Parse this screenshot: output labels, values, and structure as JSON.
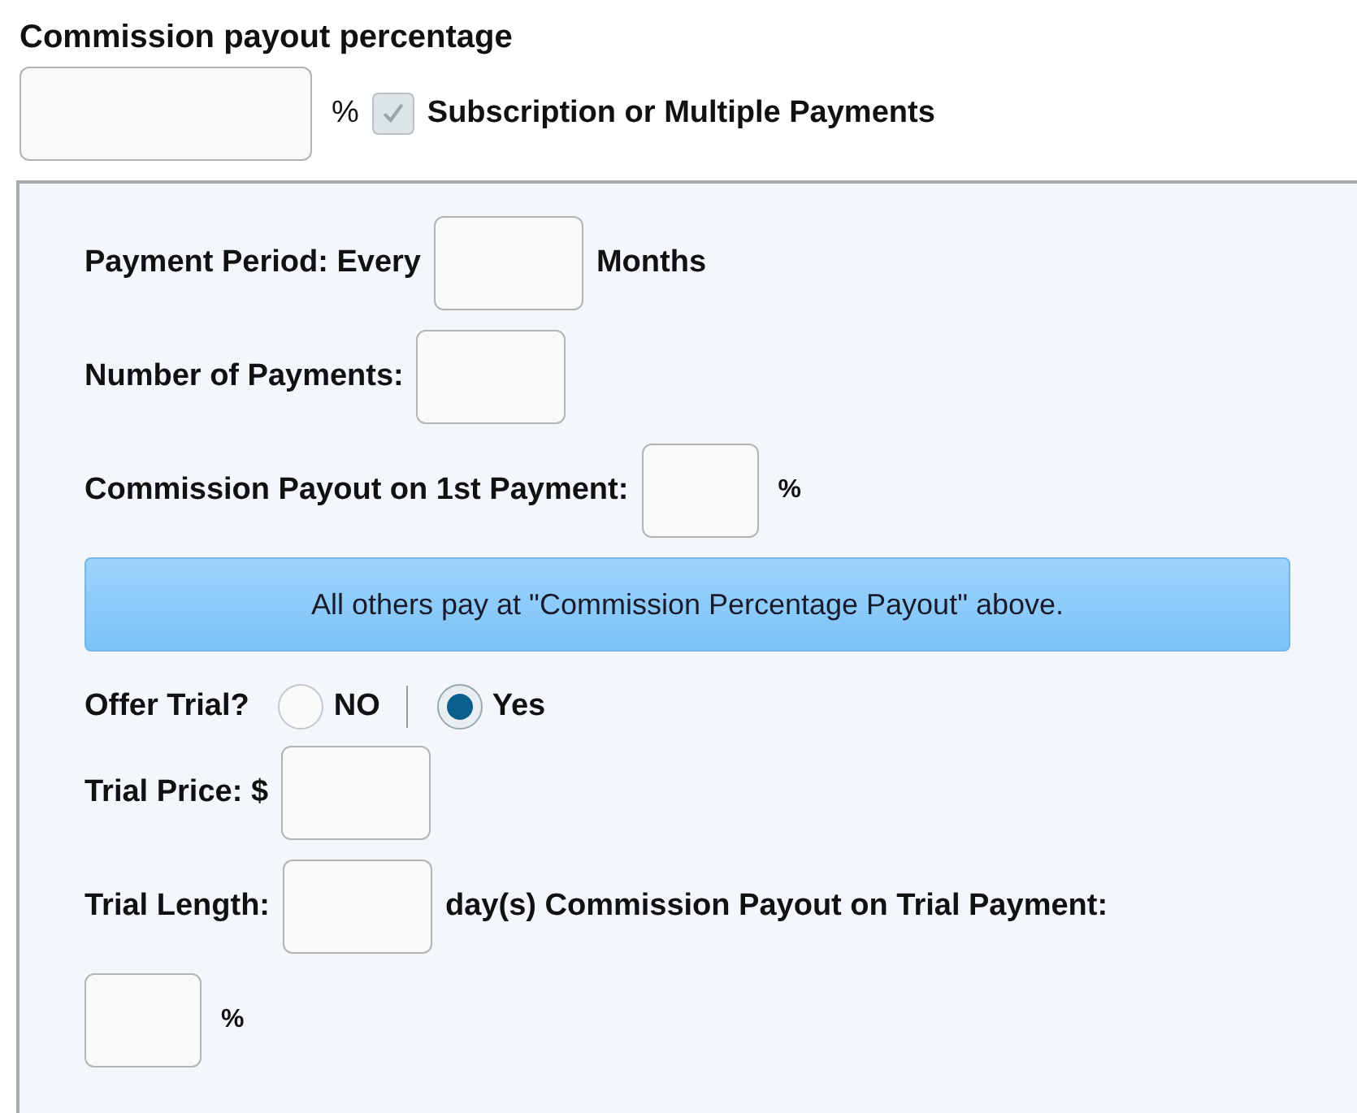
{
  "commission": {
    "label": "Commission payout percentage",
    "unit": "%"
  },
  "subscription": {
    "label": "Subscription or Multiple Payments",
    "checked": true,
    "disabled": true
  },
  "payment_period": {
    "label": "Payment Period: Every",
    "unit": "Months"
  },
  "number_of_payments": {
    "label": "Number of Payments:"
  },
  "first_payment": {
    "label": "Commission Payout on 1st Payment:",
    "unit": "%"
  },
  "notice": "All others pay at \"Commission Percentage Payout\" above.",
  "offer_trial": {
    "label": "Offer Trial?",
    "options": [
      {
        "label": "NO",
        "selected": false
      },
      {
        "label": "Yes",
        "selected": true
      }
    ]
  },
  "trial_price": {
    "label": "Trial Price: $"
  },
  "trial_length": {
    "label": "Trial Length:",
    "unit": "day(s)"
  },
  "trial_payout": {
    "label": "Commission Payout on Trial Payment:",
    "unit": "%"
  }
}
